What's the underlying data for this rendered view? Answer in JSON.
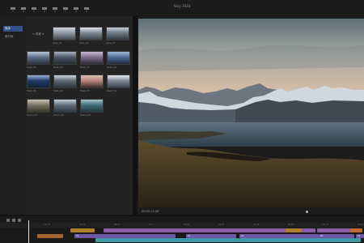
{
  "window": {
    "title": "Vary 2024"
  },
  "toolbar": [
    "A",
    "B",
    "C",
    "D",
    "E",
    "F",
    "G",
    "H"
  ],
  "sidebar": {
    "items": [
      "媒体",
      "素材库"
    ],
    "selected": 0
  },
  "browser": {
    "breadcrumb": "< 风景 ▾",
    "thumbnails": [
      {
        "caption": "Lake_01"
      },
      {
        "caption": "Lake_02"
      },
      {
        "caption": "Lake_03"
      },
      {
        "caption": "Dusk_01"
      },
      {
        "caption": "Dusk_02"
      },
      {
        "caption": "Dusk_03"
      },
      {
        "caption": "Dusk_04"
      },
      {
        "caption": "Peak_01"
      },
      {
        "caption": "Peak_02"
      },
      {
        "caption": "Peak_03"
      },
      {
        "caption": "Peak_04"
      },
      {
        "caption": "Shore_01"
      },
      {
        "caption": "Shore_02"
      },
      {
        "caption": "Shore_03"
      }
    ]
  },
  "viewer": {
    "timecode": "00:00:12:08"
  },
  "timeline": {
    "ruler": [
      "00:00",
      "00:05",
      "00:10",
      "00:15",
      "00:20",
      "00:25",
      "00:30",
      "00:35",
      "00:40",
      "00:45"
    ],
    "clips": [
      {
        "label": "",
        "color": "#a5662e"
      },
      {
        "label": "",
        "color": "#b07d28"
      },
      {
        "label": "",
        "color": "#8a5ca8"
      },
      {
        "label": "",
        "color": "#b07d28"
      },
      {
        "label": "",
        "color": "#8a5ca8"
      },
      {
        "label": "",
        "color": "#c46a2e"
      },
      {
        "label": "01",
        "color": "#6d58a8"
      },
      {
        "label": "02",
        "color": "#6d58a8"
      },
      {
        "label": "03",
        "color": "#6d58a8"
      },
      {
        "label": "04",
        "color": "#6d58a8"
      },
      {
        "label": "05",
        "color": "#6d58a8"
      },
      {
        "label": "",
        "color": "#3f9aa5"
      },
      {
        "label": "",
        "color": "#3f9aa5"
      }
    ]
  }
}
